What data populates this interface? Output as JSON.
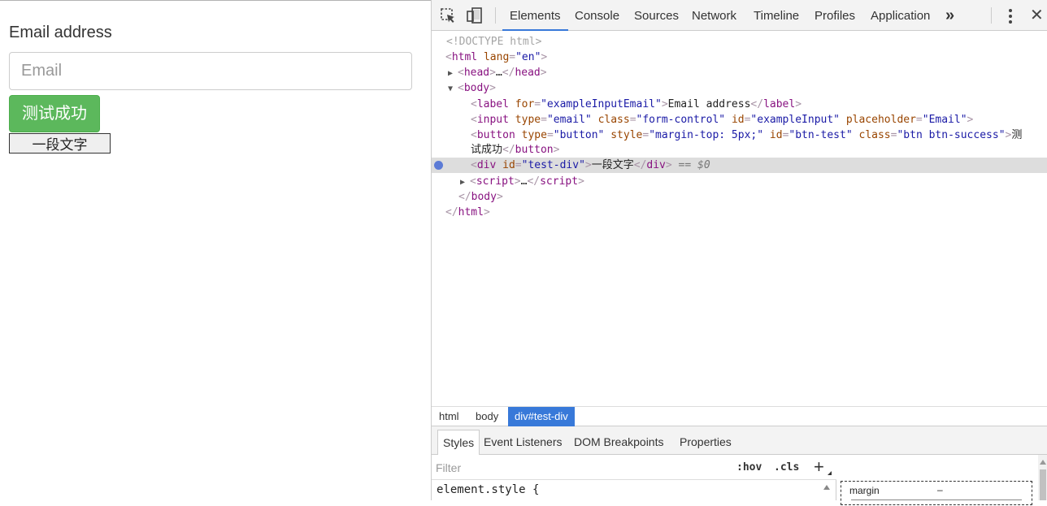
{
  "page": {
    "label": "Email address",
    "input_placeholder": "Email",
    "button_label": "测试成功",
    "div_text": "一段文字"
  },
  "devtools": {
    "tabs": [
      "Elements",
      "Console",
      "Sources",
      "Network",
      "Timeline",
      "Profiles",
      "Application"
    ],
    "active_tab": "Elements",
    "more_label": "»",
    "close_label": "✕",
    "tree": {
      "doctype": "<!DOCTYPE html>",
      "html_tag": "html",
      "html_attr": "lang",
      "html_val": "\"en\"",
      "head_tag": "head",
      "head_ellipsis": "…",
      "body_tag": "body",
      "label_tag": "label",
      "label_attr": "for",
      "label_val": "\"exampleInputEmail\"",
      "label_text": "Email address",
      "input_tag": "input",
      "input_type_attr": "type",
      "input_type_val": "\"email\"",
      "input_class_attr": "class",
      "input_class_val": "\"form-control\"",
      "input_id_attr": "id",
      "input_id_val": "\"exampleInput\"",
      "input_ph_attr": "placeholder",
      "input_ph_val": "\"Email\"",
      "button_tag": "button",
      "button_type_attr": "type",
      "button_type_val": "\"button\"",
      "button_style_attr": "style",
      "button_style_val": "\"margin-top: 5px;\"",
      "button_id_attr": "id",
      "button_id_val": "\"btn-test\"",
      "button_class_attr": "class",
      "button_class_val": "\"btn btn-success\"",
      "button_text_start": "测",
      "button_text_rest": "试成功",
      "div_tag": "div",
      "div_attr": "id",
      "div_val": "\"test-div\"",
      "div_text": "一段文字",
      "div_dollar": "== $0",
      "script_tag": "script",
      "script_ellipsis": "…"
    },
    "breadcrumbs": [
      "html",
      "body",
      "div#test-div"
    ],
    "active_breadcrumb": "div#test-div",
    "styles_tabs": [
      "Styles",
      "Event Listeners",
      "DOM Breakpoints",
      "Properties"
    ],
    "active_styles_tab": "Styles",
    "filter_placeholder": "Filter",
    "hov_label": ":hov",
    "cls_label": ".cls",
    "add_rule_label": "+",
    "element_style": "element.style {",
    "box_model": {
      "margin_label": "margin",
      "margin_value": "–"
    },
    "colors": {
      "accent": "#3879d9",
      "selected_row": "#dddddd",
      "button_green": "#5cb85c"
    }
  }
}
